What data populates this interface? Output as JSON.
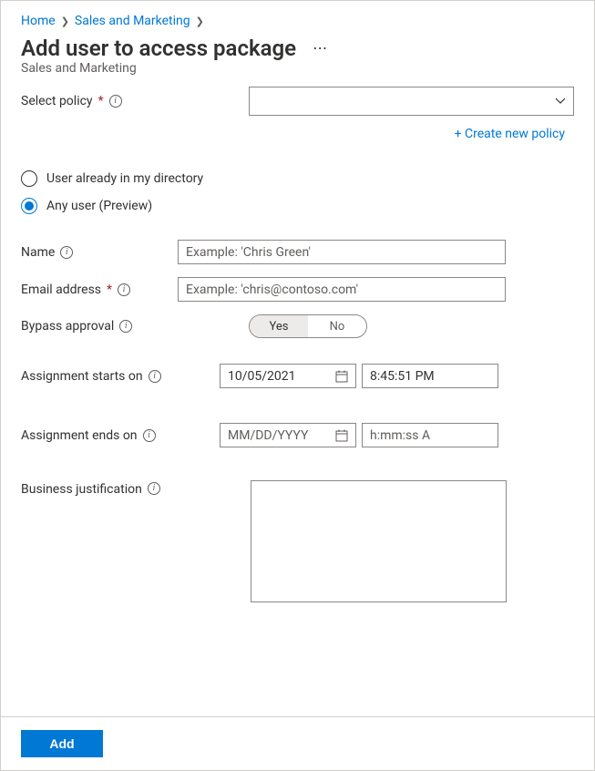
{
  "breadcrumb": {
    "home": "Home",
    "second": "Sales and Marketing"
  },
  "title": "Add user to access package",
  "subtitle": "Sales and Marketing",
  "selectPolicy": {
    "label": "Select policy",
    "createLink": "+ Create new policy"
  },
  "radios": {
    "opt1": "User already in my directory",
    "opt2": "Any user (Preview)"
  },
  "name": {
    "label": "Name",
    "placeholder": "Example: 'Chris Green'",
    "value": ""
  },
  "email": {
    "label": "Email address",
    "placeholder": "Example: 'chris@contoso.com'",
    "value": ""
  },
  "bypass": {
    "label": "Bypass approval",
    "yes": "Yes",
    "no": "No"
  },
  "starts": {
    "label": "Assignment starts on",
    "date": "10/05/2021",
    "time": "8:45:51 PM"
  },
  "ends": {
    "label": "Assignment ends on",
    "datePlaceholder": "MM/DD/YYYY",
    "timePlaceholder": "h:mm:ss A"
  },
  "justification": {
    "label": "Business justification",
    "value": ""
  },
  "footer": {
    "addButton": "Add"
  }
}
